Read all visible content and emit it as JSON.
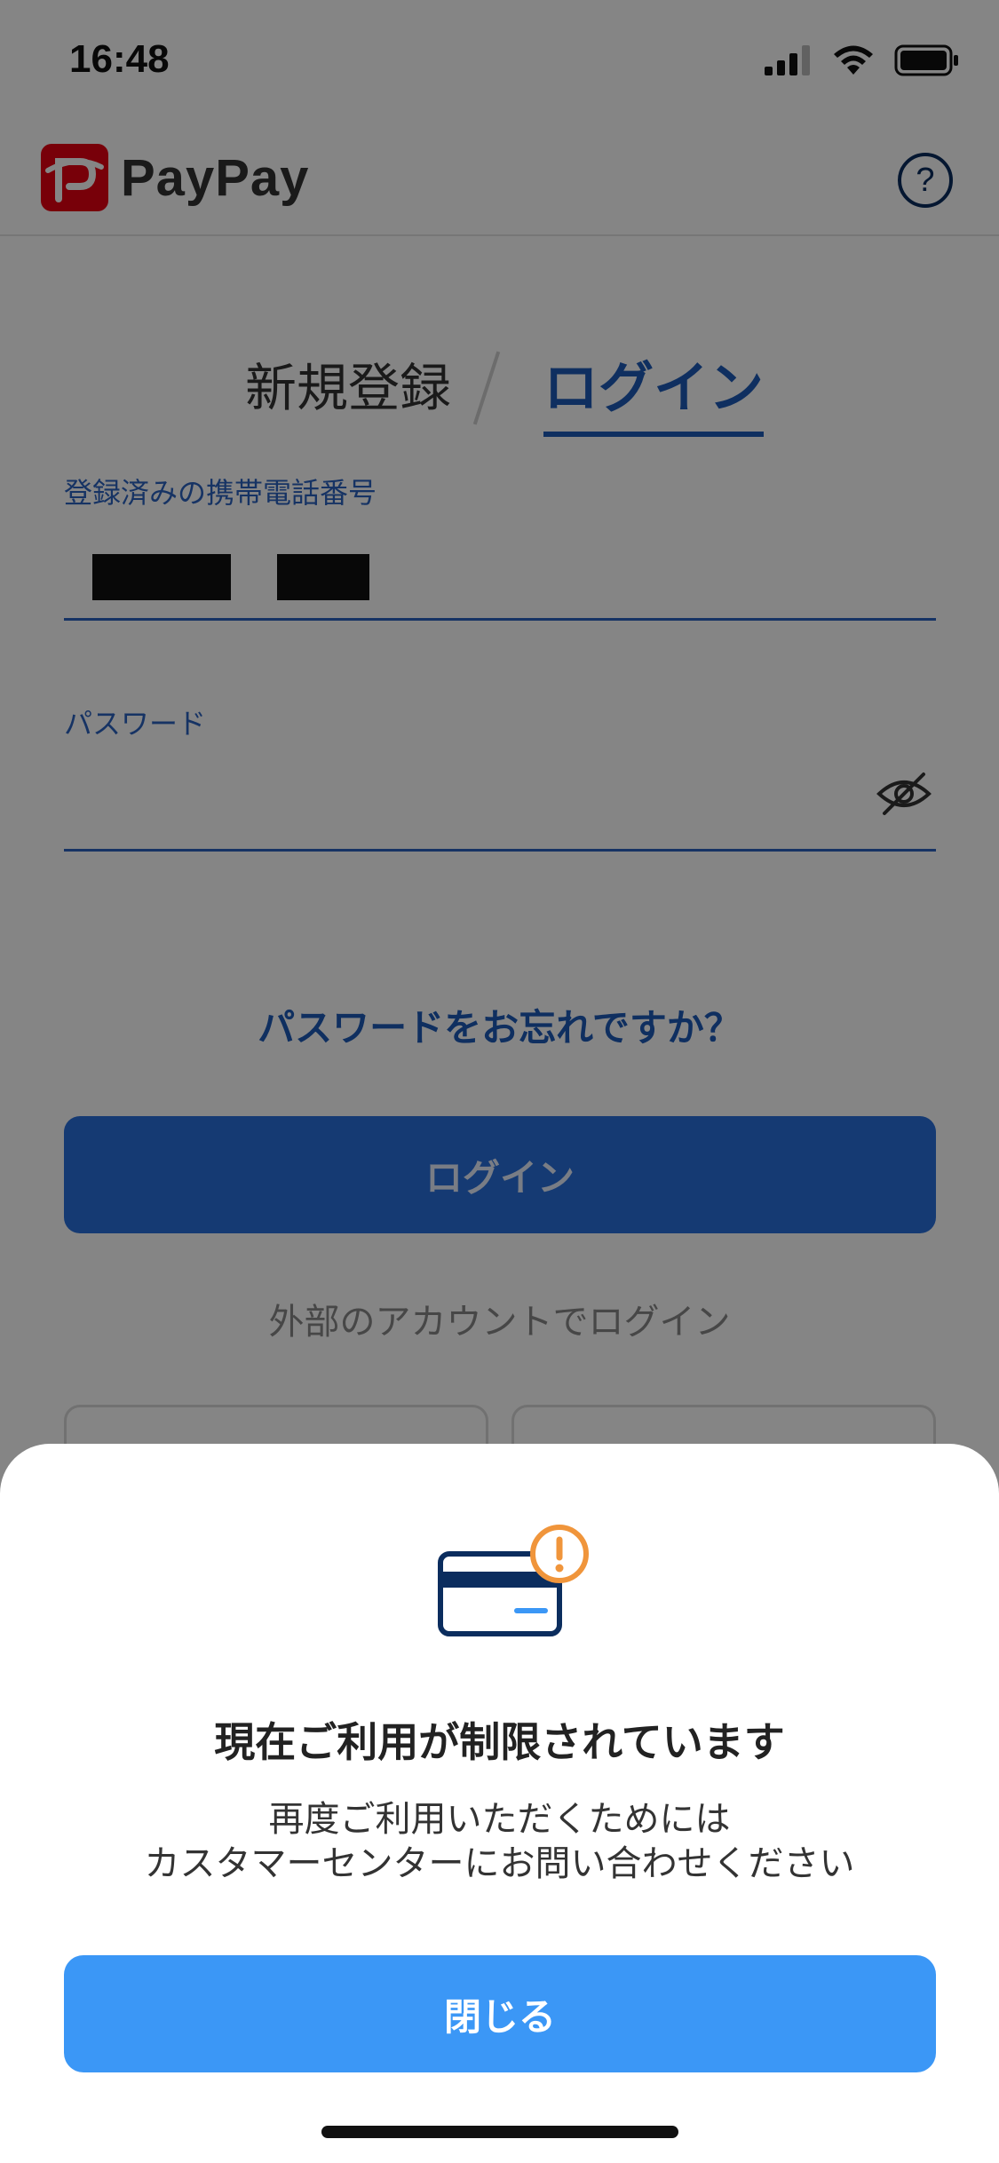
{
  "status_bar": {
    "time": "16:48"
  },
  "header": {
    "brand": "PayPay",
    "help_symbol": "?"
  },
  "auth_tabs": {
    "register": "新規登録",
    "login": "ログイン"
  },
  "phone_field": {
    "label": "登録済みの携帯電話番号"
  },
  "password_field": {
    "label": "パスワード"
  },
  "forgot_password": "パスワードをお忘れですか？",
  "login_button": "ログイン",
  "external_login": "外部のアカウントでログイン",
  "dialog": {
    "title": "現在ご利用が制限されています",
    "message_line1": "再度ご利用いただくためには",
    "message_line2": "カスタマーセンターにお問い合わせください",
    "close_button": "閉じる"
  },
  "icons": {
    "signal": "cellular-signal-icon",
    "wifi": "wifi-icon",
    "battery": "battery-icon",
    "eye": "eye-slash-icon",
    "card": "credit-card-warning-icon"
  },
  "colors": {
    "brand_red": "#e60012",
    "primary_blue": "#1d5bb8",
    "dialog_button": "#3b97f6",
    "warning_orange": "#f0953b",
    "card_navy": "#0b2d5e"
  }
}
